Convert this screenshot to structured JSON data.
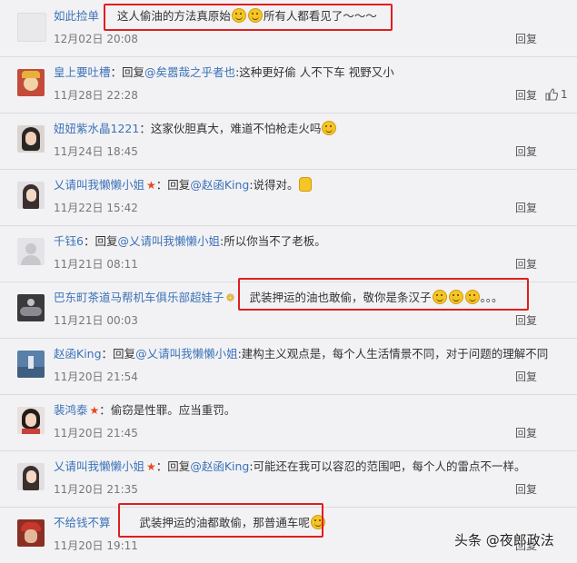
{
  "comments": [
    {
      "user": "如此捡单",
      "verified": "",
      "content_prefix": "",
      "mention": "",
      "content": "这人偷油的方法真原始",
      "content_after_emoji": "所有人都看见了～～～",
      "time": "12月02日 20:08",
      "reply": "回复",
      "likes": ""
    },
    {
      "user": "皇上要吐槽",
      "verified": "",
      "content_prefix": "回复",
      "mention": "@矣嚣哉之乎者也",
      "content": ":这种更好偷 人不下车 视野又小",
      "time": "11月28日 22:28",
      "reply": "回复",
      "likes": "1"
    },
    {
      "user": "妞妞紫水晶1221",
      "verified": "",
      "content_prefix": "",
      "mention": "",
      "content": "这家伙胆真大，难道不怕枪走火吗",
      "time": "11月24日 18:45",
      "reply": "回复",
      "likes": ""
    },
    {
      "user": "乂请叫我懒懒小姐",
      "verified": "star",
      "content_prefix": "回复",
      "mention": "@赵函King",
      "content": ":说得对。",
      "time": "11月22日 15:42",
      "reply": "回复",
      "likes": ""
    },
    {
      "user": "千钰6",
      "verified": "",
      "content_prefix": "回复",
      "mention": "@乂请叫我懒懒小姐",
      "content": ":所以你当不了老板。",
      "time": "11月21日 08:11",
      "reply": "回复",
      "likes": ""
    },
    {
      "user": "巴东町茶道马帮机车俱乐部超娃子",
      "verified": "medal",
      "content_prefix": "",
      "mention": "",
      "content": "武装押运的油也敢偷，敬你是条汉子",
      "content_tail": "。。。",
      "time": "11月21日 00:03",
      "reply": "回复",
      "likes": ""
    },
    {
      "user": "赵函King",
      "verified": "",
      "content_prefix": "回复",
      "mention": "@乂请叫我懒懒小姐",
      "content": ":建构主义观点是，每个人生活情景不同，对于问题的理解不同",
      "time": "11月20日 21:54",
      "reply": "回复",
      "likes": ""
    },
    {
      "user": "裴鸿泰",
      "verified": "star",
      "content_prefix": "",
      "mention": "",
      "content": "偷窃是性罪。应当重罚。",
      "time": "11月20日 21:45",
      "reply": "回复",
      "likes": ""
    },
    {
      "user": "乂请叫我懒懒小姐",
      "verified": "star",
      "content_prefix": "回复",
      "mention": "@赵函King",
      "content": ":可能还在我可以容忍的范围吧，每个人的雷点不一样。",
      "time": "11月20日 21:35",
      "reply": "回复",
      "likes": ""
    },
    {
      "user": "不给钱不算",
      "verified": "",
      "content_prefix": "",
      "mention": "",
      "content": "武装押运的油都敢偷，那普通车呢",
      "time": "11月20日 19:11",
      "reply": "回复",
      "likes": ""
    }
  ],
  "icons": {
    "like": "thumbs-up-icon",
    "emoji": "smiley-emoji-icon",
    "star": "star-badge-icon"
  },
  "colors": {
    "username": "#3b72b6",
    "highlight": "#e01e1e",
    "star": "#e8481e",
    "background": "#f2f2f5"
  },
  "watermark": "头条 @夜郎政法"
}
